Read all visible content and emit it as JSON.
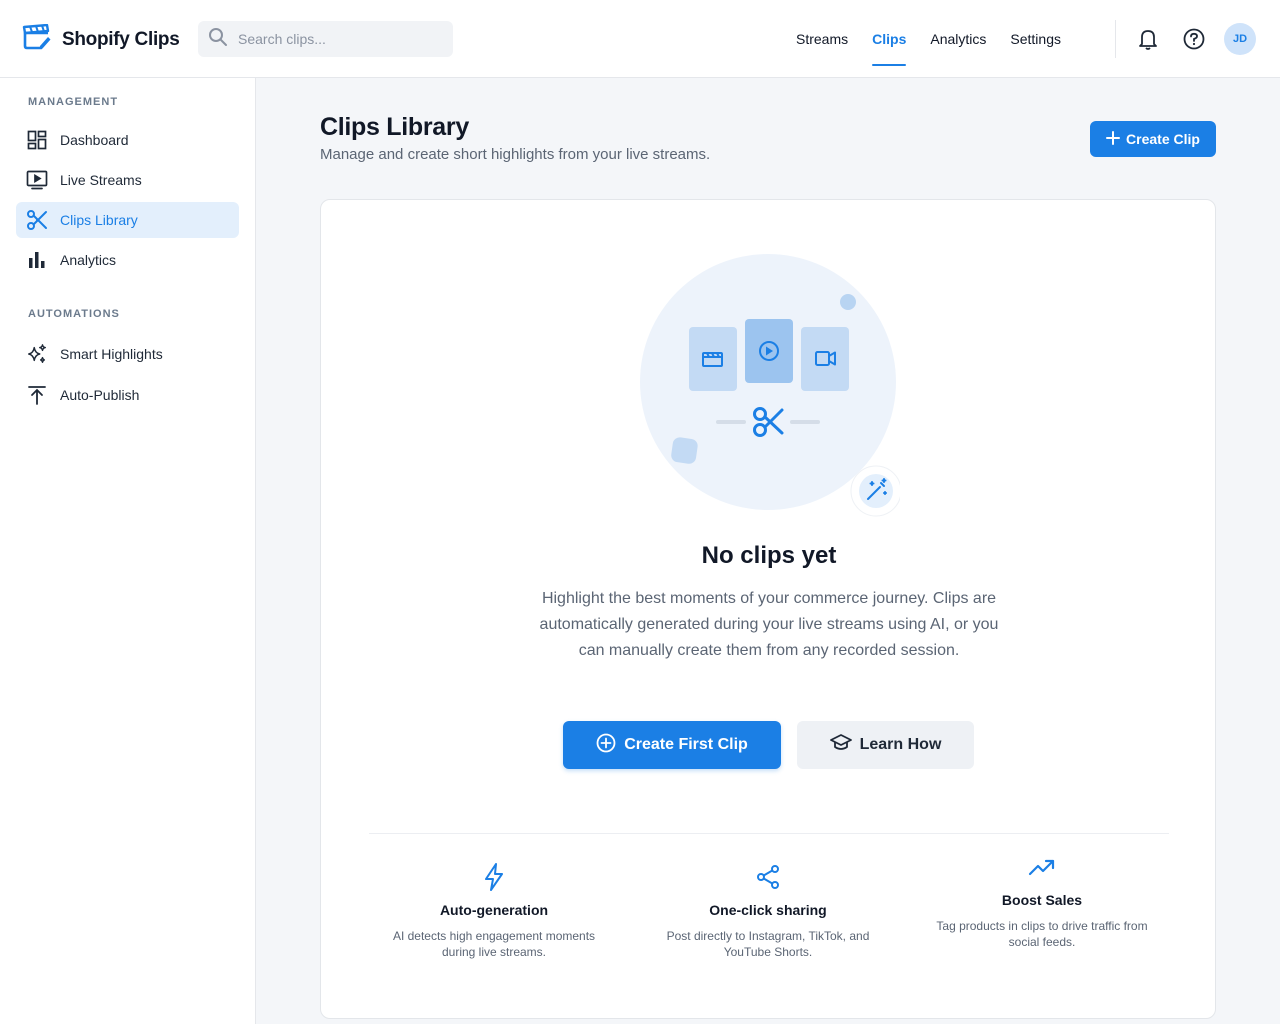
{
  "header": {
    "brand": "Shopify Clips",
    "search_placeholder": "Search clips...",
    "nav": [
      "Streams",
      "Clips",
      "Analytics",
      "Settings"
    ],
    "active_nav": "Clips",
    "avatar_initials": "JD"
  },
  "sidebar": {
    "management_title": "MANAGEMENT",
    "management_items": [
      {
        "label": "Dashboard",
        "icon": "dashboard-icon"
      },
      {
        "label": "Live Streams",
        "icon": "live-streams-icon"
      },
      {
        "label": "Clips Library",
        "icon": "scissors-icon",
        "active": true
      },
      {
        "label": "Analytics",
        "icon": "bar-chart-icon"
      }
    ],
    "automations_title": "AUTOMATIONS",
    "automation_items": [
      {
        "label": "Smart Highlights",
        "icon": "sparkles-icon"
      },
      {
        "label": "Auto-Publish",
        "icon": "upload-icon"
      }
    ]
  },
  "main": {
    "title": "Clips Library",
    "subtitle": "Manage and create short highlights from your live streams.",
    "create_button": "Create Clip",
    "empty_state": {
      "title": "No clips yet",
      "description": "Highlight the best moments of your commerce journey. Clips are automatically generated during your live streams using AI, or you can manually create them from any recorded session.",
      "primary_button": "Create First Clip",
      "secondary_button": "Learn How"
    },
    "features": [
      {
        "title": "Auto-generation",
        "description": "AI detects high engagement moments during live streams.",
        "icon": "lightning-icon"
      },
      {
        "title": "One-click sharing",
        "description": "Post directly to Instagram, TikTok, and YouTube Shorts.",
        "icon": "share-icon"
      },
      {
        "title": "Boost Sales",
        "description": "Tag products in clips to drive traffic from social feeds.",
        "icon": "trending-up-icon"
      }
    ]
  },
  "colors": {
    "accent": "#1b7fe5",
    "active_bg": "#e3effc",
    "page_bg": "#f4f6f9"
  }
}
